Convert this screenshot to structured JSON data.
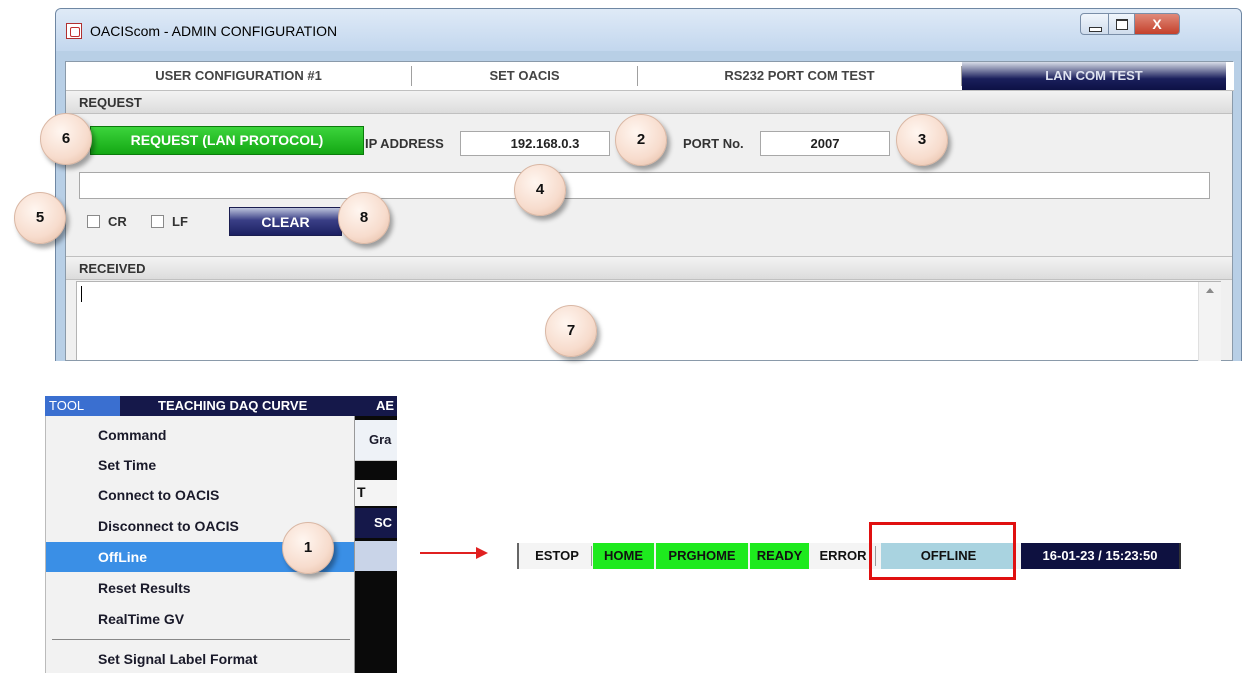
{
  "window": {
    "title": "OACIScom - ADMIN CONFIGURATION",
    "close_glyph": "X",
    "tabs": [
      {
        "label": "USER CONFIGURATION #1"
      },
      {
        "label": "SET OACIS"
      },
      {
        "label": "RS232 PORT COM TEST"
      },
      {
        "label": "LAN COM TEST",
        "active": true
      }
    ],
    "request": {
      "header": "REQUEST",
      "button_label": "REQUEST (LAN PROTOCOL)",
      "ip_label": "IP ADDRESS",
      "ip_value": "192.168.0.3",
      "port_label": "PORT No.",
      "port_value": "2007",
      "command_value": "",
      "cr_label": "CR",
      "lf_label": "LF",
      "cr_checked": false,
      "lf_checked": false,
      "clear_label": "CLEAR"
    },
    "received": {
      "header": "RECEIVED",
      "text": ""
    }
  },
  "callouts": [
    "6",
    "2",
    "3",
    "4",
    "5",
    "8",
    "7",
    "1"
  ],
  "menu": {
    "bar": [
      "TOOL",
      "TEACHING DAQ CURVE",
      "AE"
    ],
    "items": [
      "Command",
      "Set Time",
      "Connect to OACIS",
      "Disconnect to OACIS",
      "OffLine",
      "Reset Results",
      "RealTime GV",
      "Set Signal Label Format"
    ],
    "highlighted": "OffLine",
    "background_fragments": [
      "Gra",
      "T",
      "SC"
    ]
  },
  "status_bar": {
    "items": [
      "ESTOP",
      "HOME",
      "PRGHOME",
      "READY",
      "ERROR",
      "OFFLINE",
      "16-01-23 / 15:23:50"
    ],
    "colors": {
      "green": "#1eea1e",
      "offline": "#a9d3e0",
      "datetime_bg": "#0e1140"
    }
  },
  "colors": {
    "accent_blue": "#3a8fe6",
    "highlight_red": "#e01010",
    "request_green": "#14a814",
    "clear_navy": "#1c2062"
  }
}
